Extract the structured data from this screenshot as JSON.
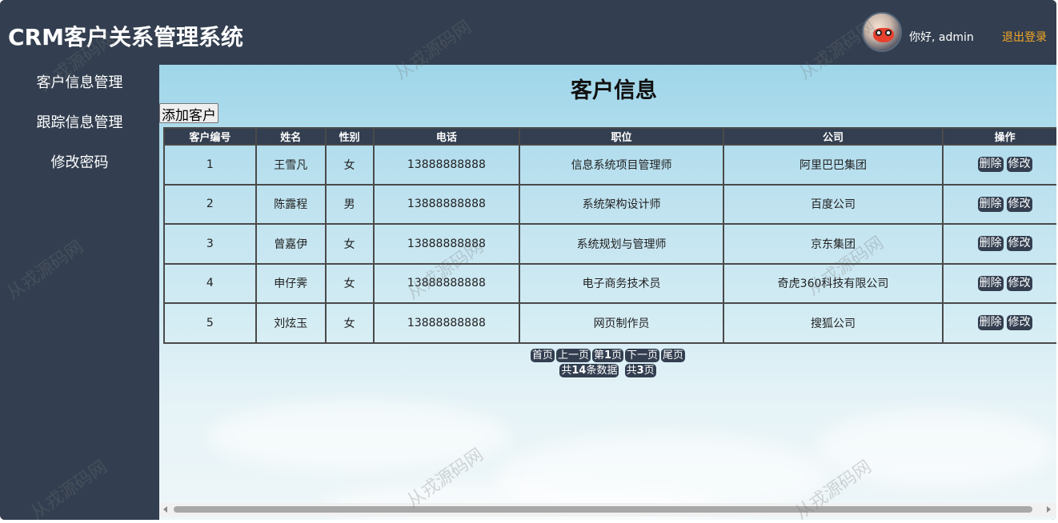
{
  "header": {
    "app_title": "CRM客户关系管理系统",
    "greeting": "你好, admin",
    "logout": "退出登录"
  },
  "sidebar": {
    "items": [
      {
        "label": "客户信息管理"
      },
      {
        "label": "跟踪信息管理"
      },
      {
        "label": "修改密码"
      }
    ]
  },
  "main": {
    "title": "客户信息",
    "add_button": "添加客户",
    "table": {
      "headers": [
        "客户编号",
        "姓名",
        "性别",
        "电话",
        "职位",
        "公司",
        "操作"
      ],
      "rows": [
        {
          "id": "1",
          "name": "王雪凡",
          "gender": "女",
          "phone": "13888888888",
          "position": "信息系统项目管理师",
          "company": "阿里巴巴集团"
        },
        {
          "id": "2",
          "name": "陈露程",
          "gender": "男",
          "phone": "13888888888",
          "position": "系统架构设计师",
          "company": "百度公司"
        },
        {
          "id": "3",
          "name": "曾嘉伊",
          "gender": "女",
          "phone": "13888888888",
          "position": "系统规划与管理师",
          "company": "京东集团"
        },
        {
          "id": "4",
          "name": "申仔霁",
          "gender": "女",
          "phone": "13888888888",
          "position": "电子商务技术员",
          "company": "奇虎360科技有限公司"
        },
        {
          "id": "5",
          "name": "刘炫玉",
          "gender": "女",
          "phone": "13888888888",
          "position": "网页制作员",
          "company": "搜狐公司"
        }
      ],
      "delete_label": "删除",
      "edit_label": "修改"
    },
    "pager": {
      "first": "首页",
      "prev": "上一页",
      "current_prefix": "第",
      "current_page": "1",
      "current_suffix": "页",
      "next": "下一页",
      "last": "尾页",
      "total_prefix": "共",
      "total_count": "14",
      "total_suffix": "条数据",
      "pages_prefix": "共",
      "pages_count": "3",
      "pages_suffix": "页"
    }
  },
  "watermark": "从戎源码网",
  "colors": {
    "nav_bg": "#333f50",
    "logout": "#f5a623",
    "content_bg": "#bfe2ef"
  }
}
